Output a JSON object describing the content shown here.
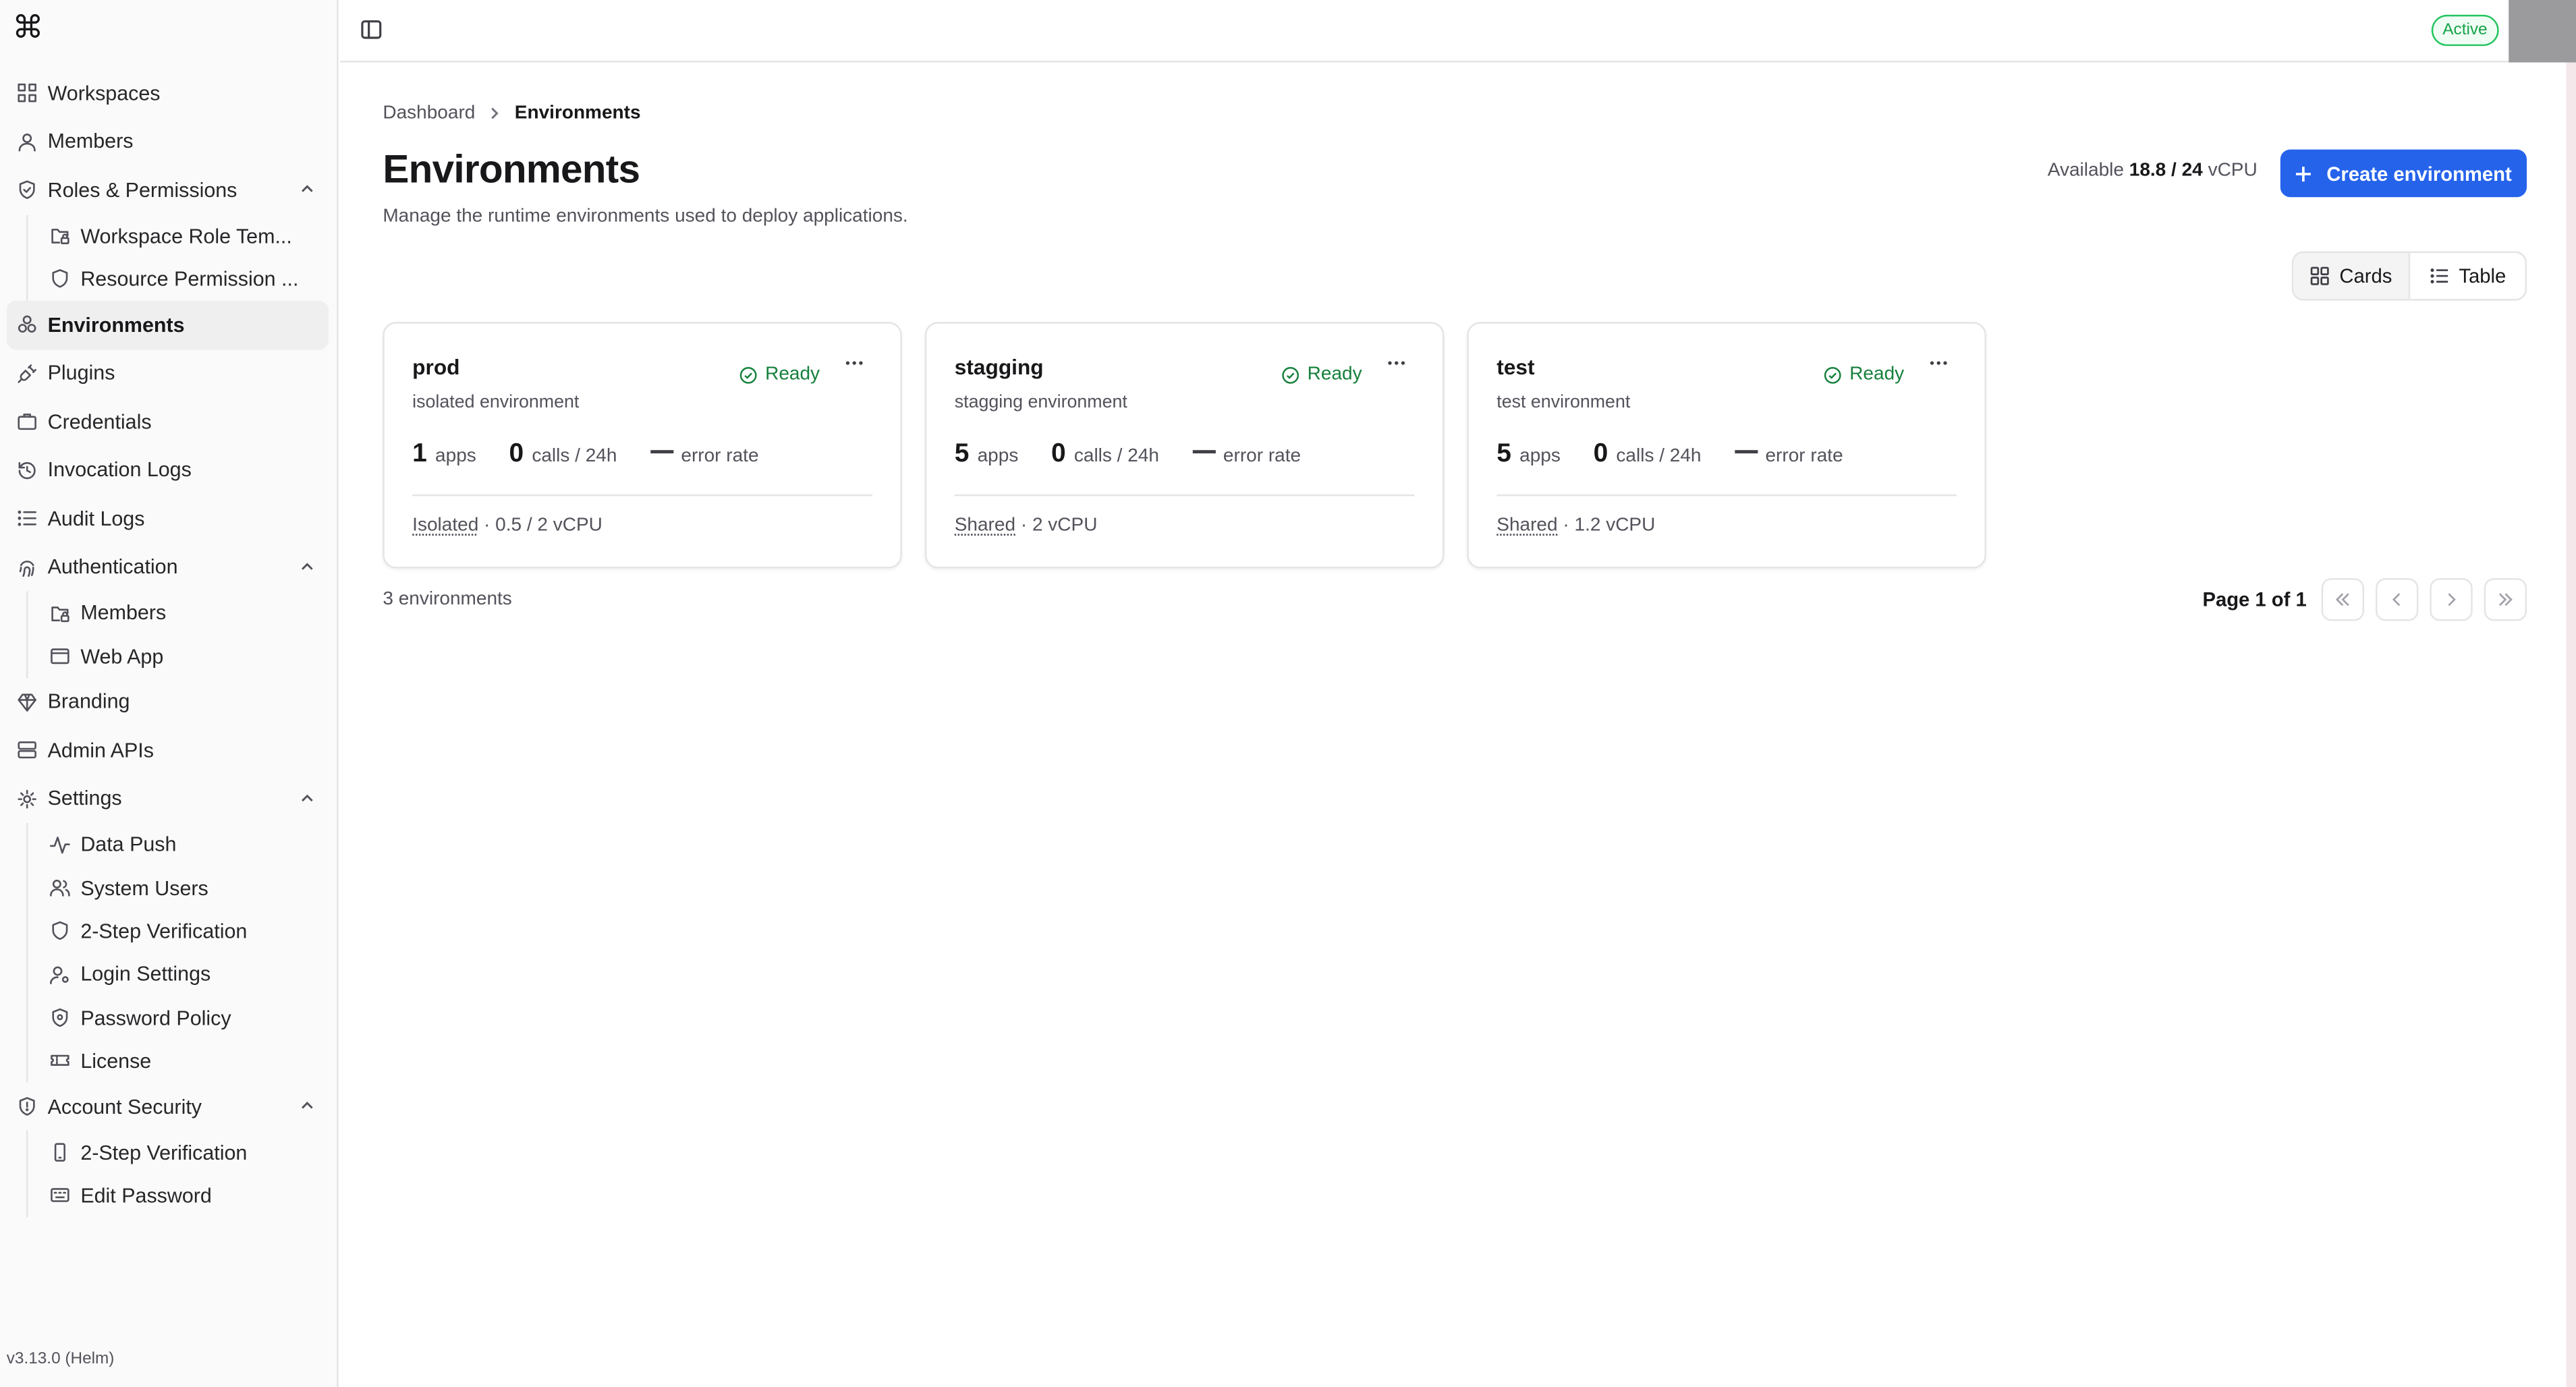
{
  "app": {
    "version": "v3.13.0 (Helm)"
  },
  "topbar": {
    "status": "Active"
  },
  "sidebar": {
    "items": [
      {
        "label": "Workspaces",
        "icon": "grid-icon"
      },
      {
        "label": "Members",
        "icon": "user-icon"
      },
      {
        "label": "Roles & Permissions",
        "icon": "shield-check-icon",
        "expanded": true,
        "children": [
          {
            "label": "Workspace Role Tem...",
            "icon": "folder-lock-icon"
          },
          {
            "label": "Resource Permission ...",
            "icon": "shield-icon"
          }
        ]
      },
      {
        "label": "Environments",
        "icon": "boxes-icon",
        "active": true
      },
      {
        "label": "Plugins",
        "icon": "plug-icon"
      },
      {
        "label": "Credentials",
        "icon": "briefcase-icon"
      },
      {
        "label": "Invocation Logs",
        "icon": "history-icon"
      },
      {
        "label": "Audit Logs",
        "icon": "list-icon"
      },
      {
        "label": "Authentication",
        "icon": "fingerprint-icon",
        "expanded": true,
        "children": [
          {
            "label": "Members",
            "icon": "folder-lock-icon"
          },
          {
            "label": "Web App",
            "icon": "browser-icon"
          }
        ]
      },
      {
        "label": "Branding",
        "icon": "gem-icon"
      },
      {
        "label": "Admin APIs",
        "icon": "server-icon"
      },
      {
        "label": "Settings",
        "icon": "gear-icon",
        "expanded": true,
        "children": [
          {
            "label": "Data Push",
            "icon": "activity-icon"
          },
          {
            "label": "System Users",
            "icon": "users-icon"
          },
          {
            "label": "2-Step Verification",
            "icon": "shield-icon"
          },
          {
            "label": "Login Settings",
            "icon": "user-cog-icon"
          },
          {
            "label": "Password Policy",
            "icon": "shield-gear-icon"
          },
          {
            "label": "License",
            "icon": "ticket-icon"
          }
        ]
      },
      {
        "label": "Account Security",
        "icon": "shield-alert-icon",
        "expanded": true,
        "children": [
          {
            "label": "2-Step Verification",
            "icon": "smartphone-icon"
          },
          {
            "label": "Edit Password",
            "icon": "keyboard-icon"
          }
        ]
      }
    ]
  },
  "breadcrumb": {
    "parent": "Dashboard",
    "current": "Environments"
  },
  "page": {
    "title": "Environments",
    "subtitle": "Manage the runtime environments used to deploy applications.",
    "available_label": "Available",
    "available_value": "18.8 / 24",
    "available_unit": "vCPU",
    "create_label": "Create environment"
  },
  "view_toggle": {
    "cards": "Cards",
    "table": "Table",
    "selected": "Cards"
  },
  "environments": [
    {
      "name": "prod",
      "description": "isolated environment",
      "status": "Ready",
      "apps": "1",
      "apps_label": "apps",
      "calls": "0",
      "calls_label": "calls / 24h",
      "error_label": "error rate",
      "mode": "Isolated",
      "resources": " · 0.5 / 2 vCPU"
    },
    {
      "name": "stagging",
      "description": "stagging environment",
      "status": "Ready",
      "apps": "5",
      "apps_label": "apps",
      "calls": "0",
      "calls_label": "calls / 24h",
      "error_label": "error rate",
      "mode": "Shared",
      "resources": " · 2 vCPU"
    },
    {
      "name": "test",
      "description": "test environment",
      "status": "Ready",
      "apps": "5",
      "apps_label": "apps",
      "calls": "0",
      "calls_label": "calls / 24h",
      "error_label": "error rate",
      "mode": "Shared",
      "resources": " · 1.2 vCPU"
    }
  ],
  "footer": {
    "count": "3 environments",
    "page": "Page 1 of 1"
  },
  "colors": {
    "accent": "#2563eb",
    "ready": "#16803c",
    "active_badge": "#22c55e"
  }
}
